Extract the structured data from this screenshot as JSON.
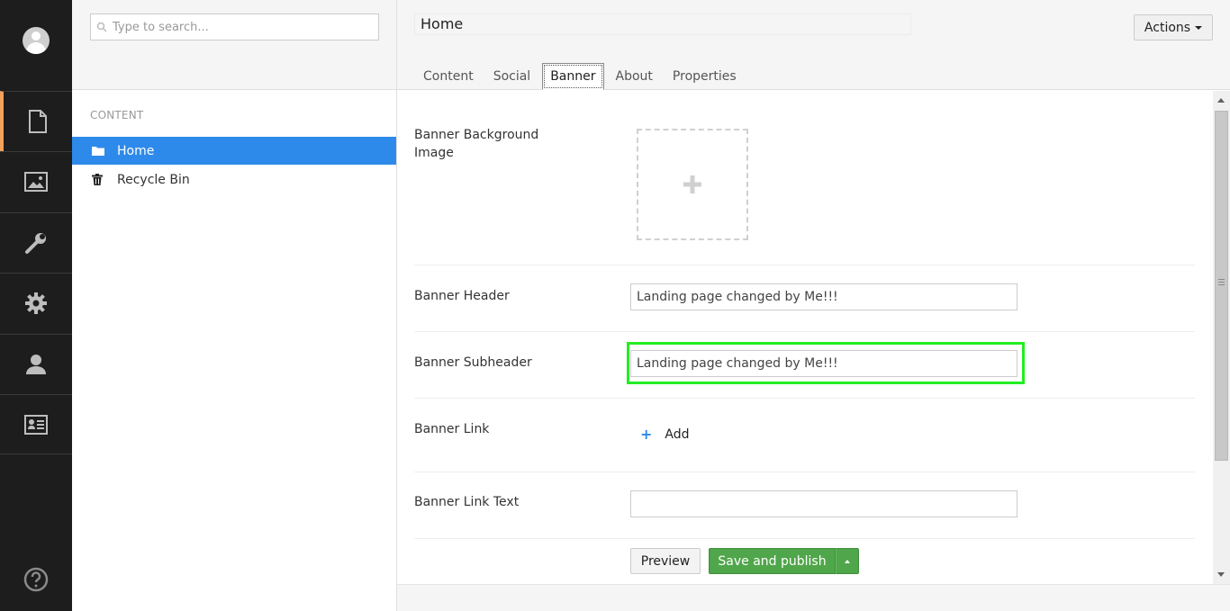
{
  "colors": {
    "sidebar_bg": "#1d1d1d",
    "active_accent": "#f5a15b",
    "selection": "#2e8aea",
    "publish_green": "#50a64a",
    "highlight": "#22ee22"
  },
  "sections": [
    {
      "icon": "content-document-icon",
      "active": true
    },
    {
      "icon": "media-image-icon"
    },
    {
      "icon": "settings-wrench-icon"
    },
    {
      "icon": "developer-gear-icon"
    },
    {
      "icon": "users-person-icon"
    },
    {
      "icon": "members-card-icon"
    }
  ],
  "search": {
    "placeholder": "Type to search..."
  },
  "tree": {
    "section_label": "CONTENT",
    "items": [
      {
        "label": "Home",
        "icon": "folder-icon",
        "selected": true
      },
      {
        "label": "Recycle Bin",
        "icon": "trash-icon"
      }
    ]
  },
  "editor": {
    "page_name": "Home",
    "actions_label": "Actions",
    "tabs": [
      "Content",
      "Social",
      "Banner",
      "About",
      "Properties"
    ],
    "active_tab": "Banner"
  },
  "props": {
    "bg_image_label": "Banner Background Image",
    "header_label": "Banner Header",
    "header_value": "Landing page changed by Me!!!",
    "subheader_label": "Banner Subheader",
    "subheader_value": "Landing page changed by Me!!!",
    "link_label": "Banner Link",
    "add_label": "Add",
    "link_text_label": "Banner Link Text",
    "link_text_value": ""
  },
  "buttons": {
    "preview": "Preview",
    "save_publish": "Save and publish"
  }
}
